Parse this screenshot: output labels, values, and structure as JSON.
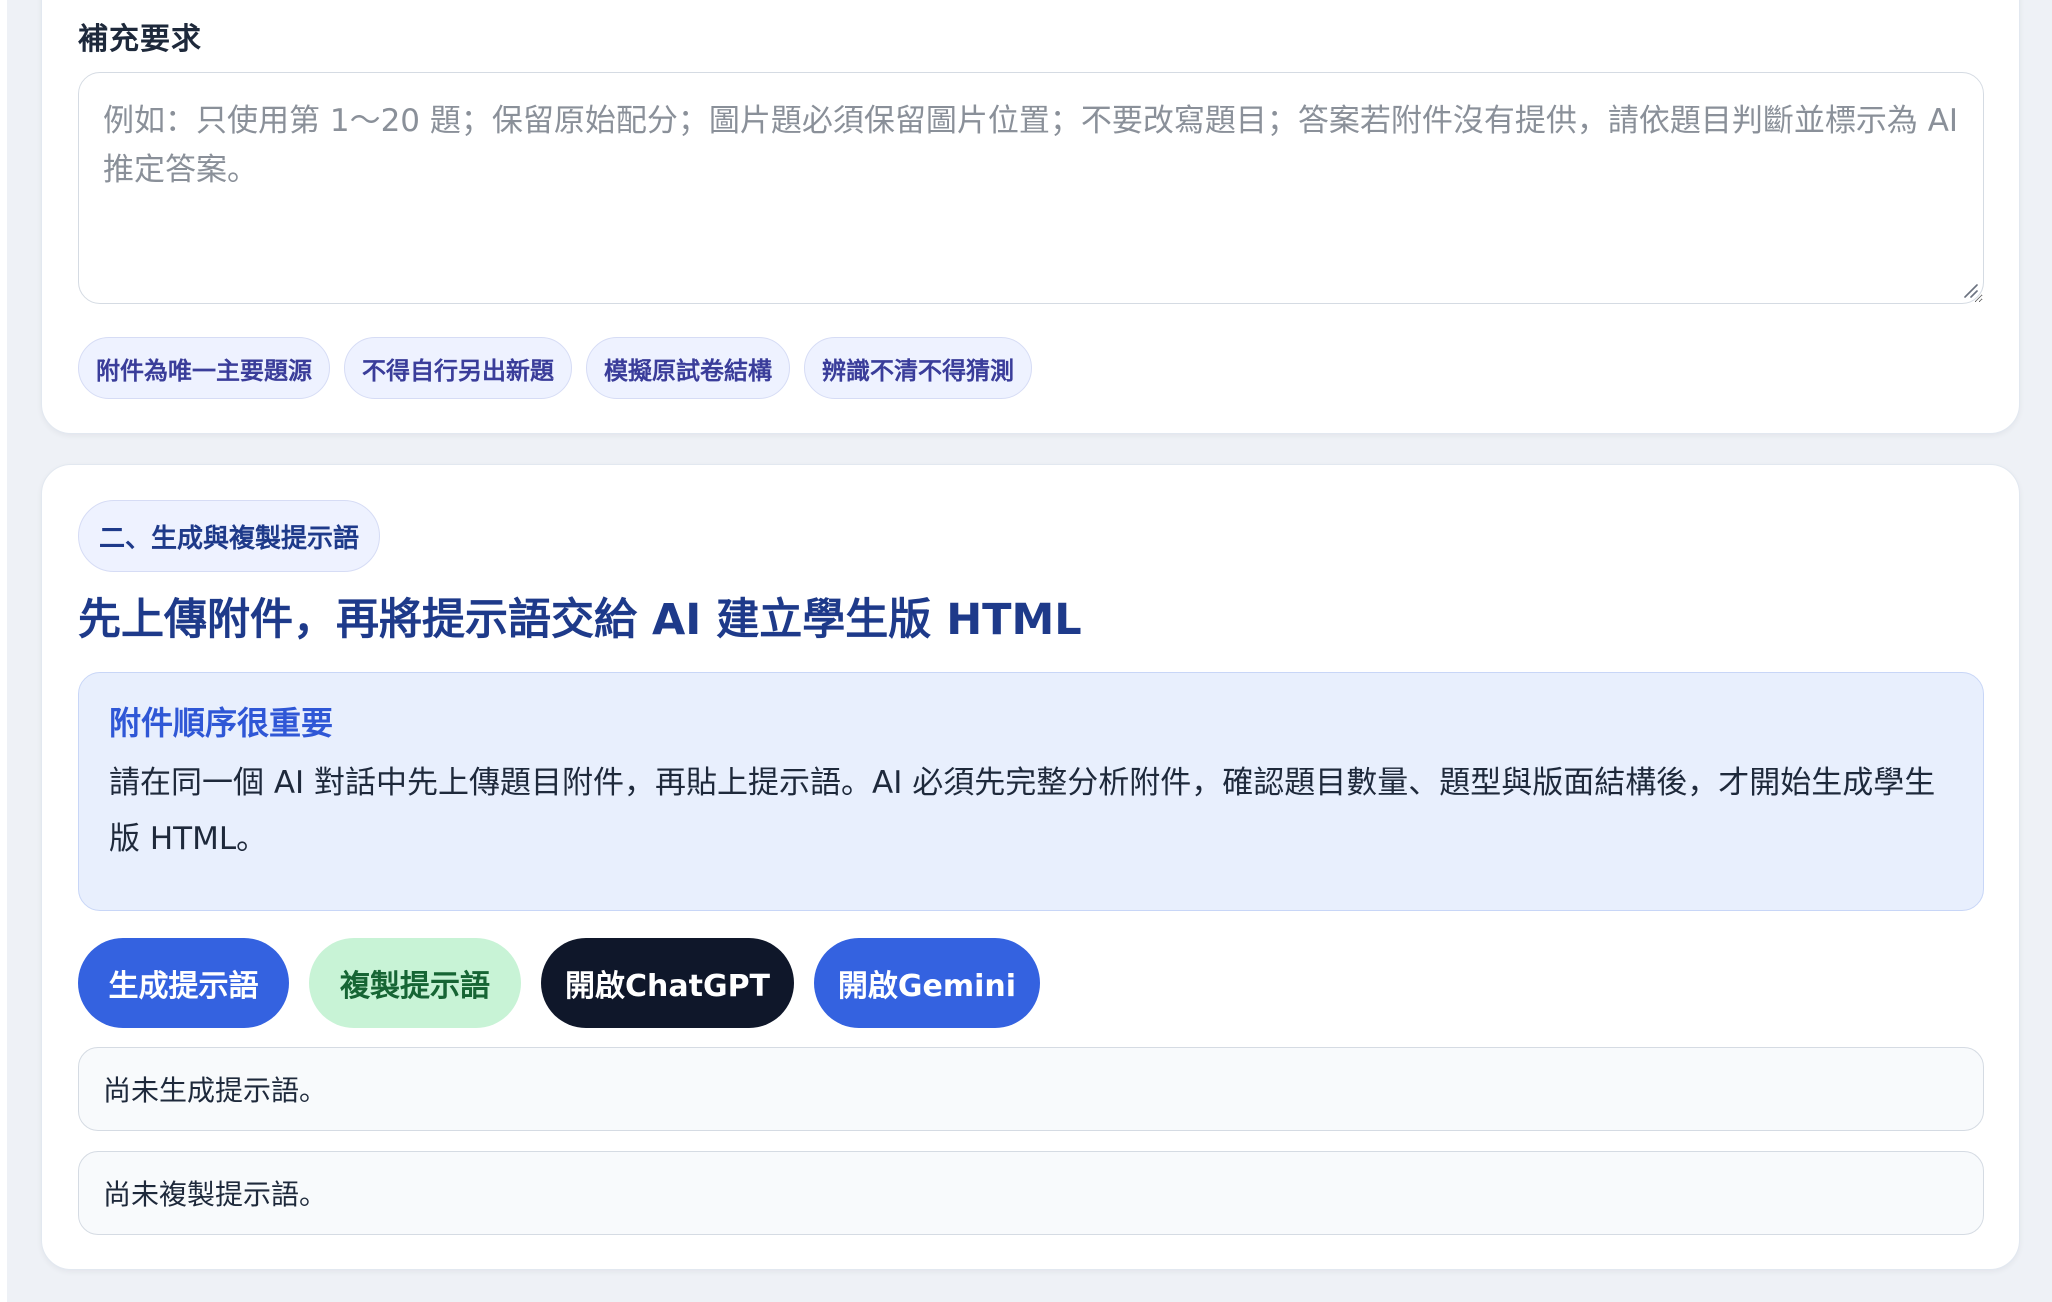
{
  "supplement": {
    "label": "補充要求",
    "placeholder": "例如：只使用第 1～20 題；保留原始配分；圖片題必須保留圖片位置；不要改寫題目；答案若附件沒有提供，請依題目判斷並標示為 AI 推定答案。",
    "value": ""
  },
  "chips": [
    {
      "label": "附件為唯一主要題源"
    },
    {
      "label": "不得自行另出新題"
    },
    {
      "label": "模擬原試卷結構"
    },
    {
      "label": "辨識不清不得猜測"
    }
  ],
  "section": {
    "pill": "二、生成與複製提示語",
    "heading": "先上傳附件，再將提示語交給 AI 建立學生版 HTML"
  },
  "notice": {
    "title": "附件順序很重要",
    "body": "請在同一個 AI 對話中先上傳題目附件，再貼上提示語。AI 必須先完整分析附件，確認題目數量、題型與版面結構後，才開始生成學生版 HTML。"
  },
  "buttons": {
    "generate": "生成提示語",
    "copy": "複製提示語",
    "chatgpt": "開啟ChatGPT",
    "gemini": "開啟Gemini"
  },
  "status": {
    "generate": "尚未生成提示語。",
    "copy": "尚未複製提示語。"
  },
  "colors": {
    "primary": "#3462e0",
    "copy_button_bg": "#c8f3d6",
    "copy_button_text": "#166534",
    "dark_button": "#0f172a",
    "chip_bg": "#eef2ff",
    "chip_text": "#3a3d9a",
    "heading": "#1e3a8a",
    "notice_bg": "#e8effd",
    "notice_title": "#2f57d6",
    "page_bg": "#eef1f6"
  },
  "icons": {
    "resize_handle": "resize-handle-icon"
  }
}
